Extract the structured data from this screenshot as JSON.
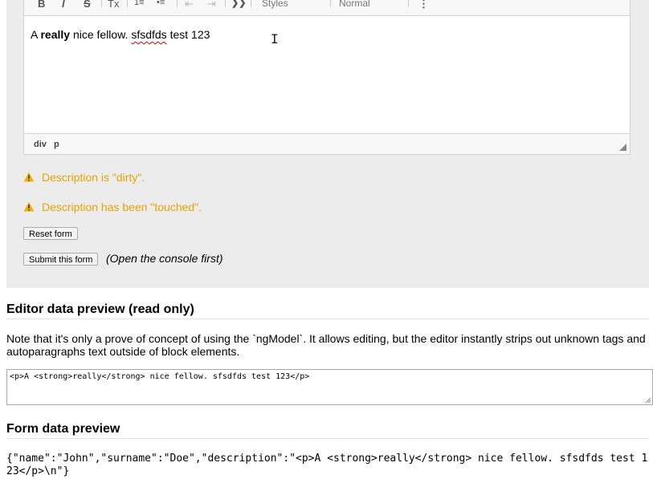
{
  "editor": {
    "toolbar": {
      "bold_label": "B",
      "italic_label": "I",
      "strike_label": "S",
      "remove_format_label": "Tx",
      "numbered_list_label": "1≡",
      "bulleted_list_label": "•≡",
      "outdent_label": "⇤",
      "indent_label": "⇥",
      "blockquote_label": "❯❯",
      "styles_label": "Styles",
      "format_label": "Normal",
      "more_label": "⋮"
    },
    "content": {
      "prefix": "A ",
      "bold": "really",
      "middle": " nice fellow. ",
      "misspelled": "sfsdfds",
      "suffix": " test 123"
    },
    "pathbar": [
      "div",
      "p"
    ]
  },
  "warnings": {
    "dirty": "Description is \"dirty\".",
    "touched": "Description has been \"touched\"."
  },
  "buttons": {
    "reset": "Reset form",
    "submit": "Submit this form",
    "submit_note": "(Open the console first)"
  },
  "preview": {
    "heading": "Editor data preview (read only)",
    "note": "Note that it's only a prove of concept of using the `ngModel`. It allows editing, but the editor instantly strips out unknown tags and autoparagraphs text outside of block elements.",
    "textarea_value": "<p>A <strong>really</strong> nice fellow. sfsdfds test 123</p>"
  },
  "form_preview": {
    "heading": "Form data preview",
    "json": "{\"name\":\"John\",\"surname\":\"Doe\",\"description\":\"<p>A <strong>really</strong> nice fellow. sfsdfds test 123</p>\\n\"}"
  },
  "colors": {
    "warning": "#e8a202",
    "panel": "#ececec"
  }
}
